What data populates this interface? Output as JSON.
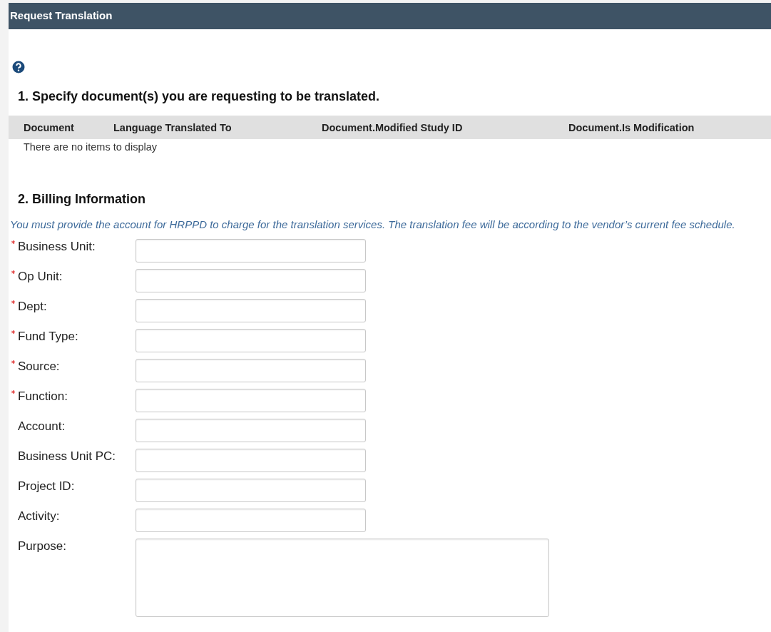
{
  "window": {
    "title": "Request Translation"
  },
  "section_1": {
    "heading": "1. Specify document(s) you are requesting to be translated.",
    "table": {
      "columns": [
        "Document",
        "Language Translated To",
        "Document.Modified Study ID",
        "Document.Is Modification"
      ],
      "empty_message": "There are no items to display"
    }
  },
  "section_2": {
    "heading": "2. Billing Information",
    "description": "You must provide the account for HRPPD to charge for the translation services.  The translation fee will be according to the vendor’s current fee schedule.",
    "fields": [
      {
        "label": "Business Unit:",
        "required": true,
        "kind": "text"
      },
      {
        "label": "Op Unit:",
        "required": true,
        "kind": "text"
      },
      {
        "label": "Dept:",
        "required": true,
        "kind": "text"
      },
      {
        "label": "Fund Type:",
        "required": true,
        "kind": "text"
      },
      {
        "label": "Source:",
        "required": true,
        "kind": "text"
      },
      {
        "label": "Function:",
        "required": true,
        "kind": "text"
      },
      {
        "label": "Account:",
        "required": false,
        "kind": "text"
      },
      {
        "label": "Business Unit PC:",
        "required": false,
        "kind": "text"
      },
      {
        "label": "Project ID:",
        "required": false,
        "kind": "text"
      },
      {
        "label": "Activity:",
        "required": false,
        "kind": "text"
      },
      {
        "label": "Purpose:",
        "required": false,
        "kind": "textarea"
      }
    ]
  }
}
